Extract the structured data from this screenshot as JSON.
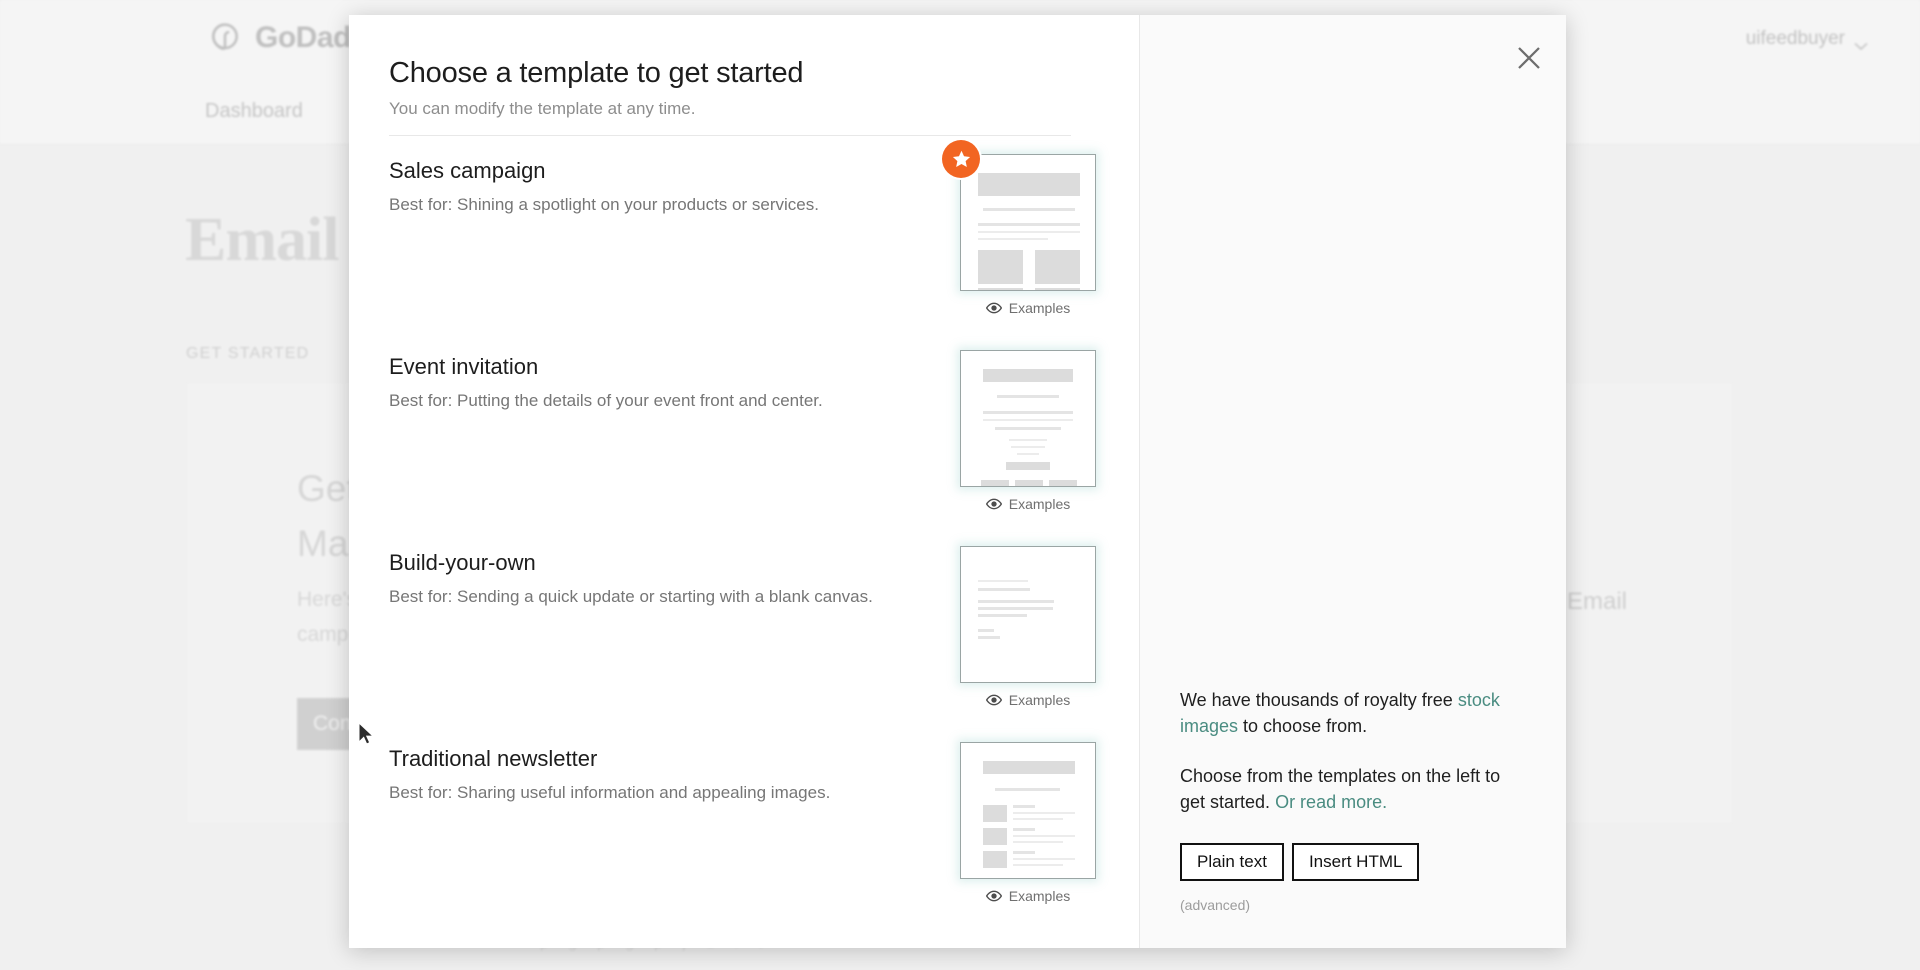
{
  "background": {
    "brand_name": "GoDaddy",
    "brand_icon": "godaddy-logo-icon",
    "account_name": "uifeedbuyer",
    "account_chevron_icon": "chevron-down-icon",
    "nav_item": "Dashboard",
    "page_title": "Email",
    "section_label": "GET STARTED",
    "card_heading_line1": "Get",
    "card_heading_line2": "Mar",
    "card_text_line1": "Here's",
    "card_text_line2": "camp",
    "card_email_word": "Email",
    "card_button": "Con",
    "footer_text": "p g      p g  p j      d       l   t"
  },
  "modal": {
    "close_icon": "close-icon",
    "title": "Choose a template to get started",
    "subtitle": "You can modify the template at any time.",
    "examples_label": "Examples",
    "examples_icon": "eye-icon",
    "featured_badge_icon": "star-icon",
    "templates": [
      {
        "name": "Sales campaign",
        "description": "Best for: Shining a spotlight on your products or services.",
        "featured": true,
        "thumb_style": "sales"
      },
      {
        "name": "Event invitation",
        "description": "Best for: Putting the details of your event front and center.",
        "featured": false,
        "thumb_style": "event"
      },
      {
        "name": "Build-your-own",
        "description": "Best for: Sending a quick update or starting with a blank canvas.",
        "featured": false,
        "thumb_style": "blank"
      },
      {
        "name": "Traditional newsletter",
        "description": "Best for: Sharing useful information and appealing images.",
        "featured": false,
        "thumb_style": "newsletter"
      }
    ],
    "right_panel": {
      "para1_pre": "We have thousands of royalty free ",
      "para1_link": "stock images",
      "para1_post": " to choose from.",
      "para2_pre": "Choose from the templates on the left to get started. ",
      "para2_link": "Or read more.",
      "button_plain_text": "Plain text",
      "button_insert_html": "Insert HTML",
      "note": "(advanced)"
    }
  },
  "colors": {
    "accent_orange": "#f26522",
    "link_teal": "#4a8c81",
    "thumb_border": "#9aa5a4"
  }
}
